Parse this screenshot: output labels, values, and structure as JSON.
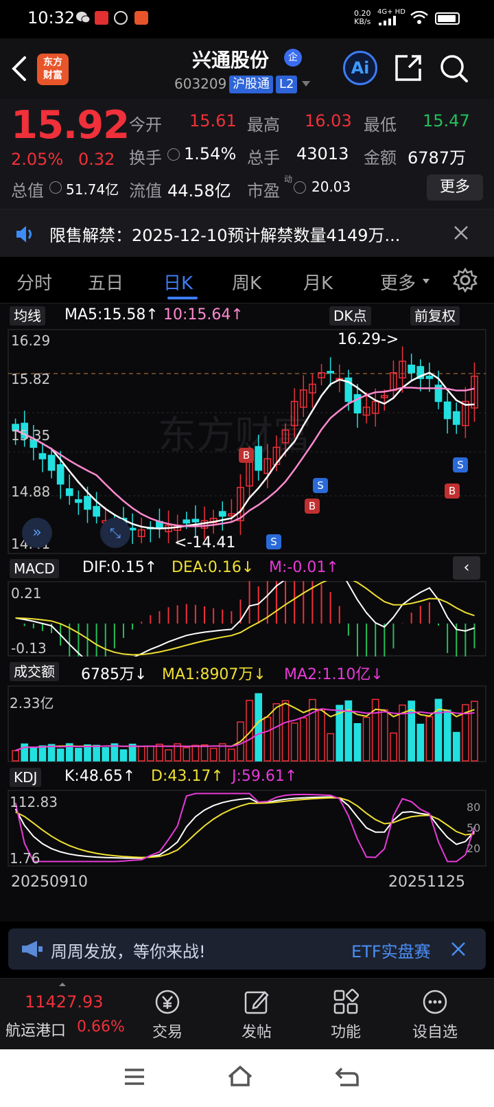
{
  "status_bar": {
    "time": "10:32",
    "net_speed": "0.20",
    "net_unit": "KB/s",
    "network": "4G+ HD"
  },
  "header": {
    "logo_line1": "东方",
    "logo_line2": "财富",
    "title": "兴通股份",
    "title_badge": "企",
    "code": "603209",
    "tag_connect": "沪股通",
    "tag_level": "L2",
    "ai_label": "Ai"
  },
  "quote": {
    "price": "15.92",
    "change_pct": "2.05%",
    "change_abs": "0.32",
    "open_label": "今开",
    "open_value": "15.61",
    "high_label": "最高",
    "high_value": "16.03",
    "low_label": "最低",
    "low_value": "15.47",
    "turnover_label": "换手",
    "turnover_value": "1.54%",
    "volume_label": "总手",
    "volume_value": "43013",
    "amount_label": "金额",
    "amount_value": "6787万",
    "mktcap_label": "总值",
    "mktcap_value": "51.74亿",
    "float_label": "流值",
    "float_value": "44.58亿",
    "pe_label": "市盈",
    "pe_sup": "动",
    "pe_value": "20.03",
    "more_label": "更多"
  },
  "notice": {
    "text": "限售解禁：2025-12-10预计解禁数量4149万..."
  },
  "tabs": [
    {
      "label": "分时"
    },
    {
      "label": "五日"
    },
    {
      "label": "日K"
    },
    {
      "label": "周K"
    },
    {
      "label": "月K"
    },
    {
      "label": "更多"
    }
  ],
  "main_chart": {
    "ma_button": "均线",
    "ma5_text": "MA5:15.58↑",
    "ma10_text": "10:15.64↑",
    "dk_button": "DK点",
    "adjust_button": "前复权",
    "y_labels": [
      "16.29",
      "15.82",
      "15.35",
      "14.88",
      "14.41"
    ],
    "high_marker": "16.29->",
    "low_marker": "<-14.41",
    "buy_label": "B",
    "sell_label": "S",
    "watermark": "东方财富"
  },
  "macd": {
    "button": "MACD",
    "dif_text": "DIF:0.15↑",
    "dea_text": "DEA:0.16↓",
    "m_text": "M:-0.01↑",
    "y_top": "0.21",
    "y_bottom": "-0.13"
  },
  "volume": {
    "button": "成交额",
    "value_text": "6785万↓",
    "ma1_text": "MA1:8907万↓",
    "ma2_text": "MA2:1.10亿↓",
    "y_top": "2.33亿"
  },
  "kdj": {
    "button": "KDJ",
    "k_text": "K:48.65↑",
    "d_text": "D:43.17↑",
    "j_text": "J:59.61↑",
    "y_top": "112.83",
    "y_bottom": "1.76",
    "levels": [
      "80",
      "50",
      "20"
    ]
  },
  "date_axis": {
    "start": "20250910",
    "end": "20251125"
  },
  "chart_data": {
    "type": "candlestick",
    "x_start": "20250910",
    "x_end": "20251125",
    "ylim": [
      14.41,
      16.29
    ],
    "series": [
      {
        "name": "MA5",
        "last": 15.58
      },
      {
        "name": "MA10",
        "last": 15.64
      }
    ],
    "high": 16.29,
    "low": 14.41,
    "colors": {
      "up": "#f0303a",
      "down": "#22e0e0",
      "ma5": "#ffffff",
      "ma10": "#ff8ad0"
    }
  },
  "banner": {
    "text": "周周发放，等你来战!",
    "link": "ETF实盘赛"
  },
  "bottom_bar": {
    "index_value": "11427.93",
    "index_name": "航运港口",
    "index_change": "0.66%",
    "items": [
      {
        "label": "交易"
      },
      {
        "label": "发帖"
      },
      {
        "label": "功能"
      },
      {
        "label": "设自选"
      }
    ]
  }
}
